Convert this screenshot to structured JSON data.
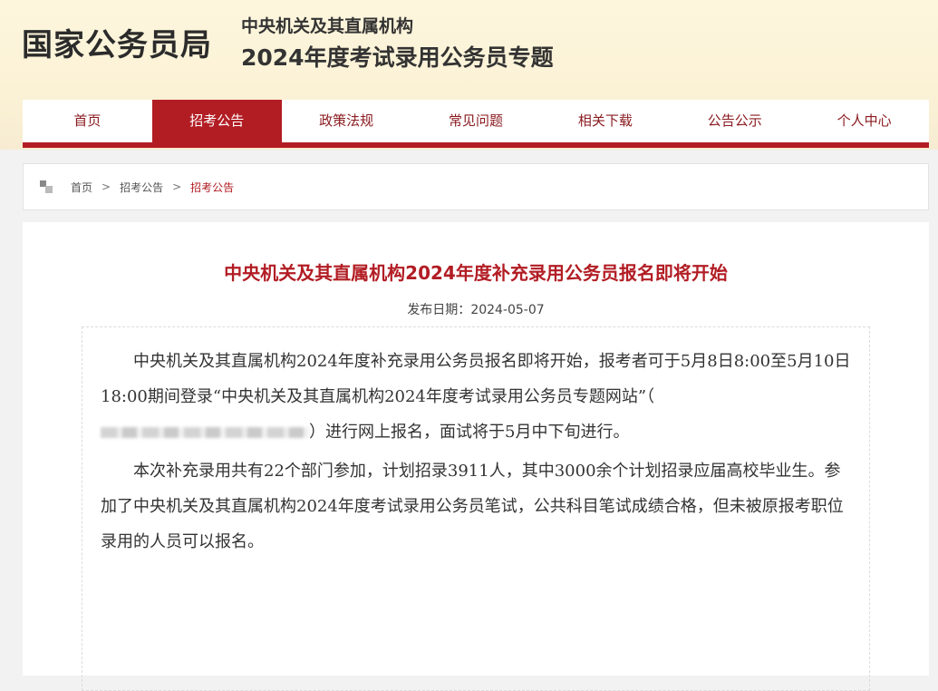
{
  "header": {
    "logo": "国家公务员局",
    "subtitle1": "中央机关及其直属机构",
    "subtitle2": "2024年度考试录用公务员专题"
  },
  "nav": {
    "items": [
      "首页",
      "招考公告",
      "政策法规",
      "常见问题",
      "相关下载",
      "公告公示",
      "个人中心"
    ],
    "active": "招考公告"
  },
  "breadcrumb": {
    "home": "首页",
    "section": "招考公告",
    "current": "招考公告",
    "separator": ">"
  },
  "article": {
    "title": "中央机关及其直属机构2024年度补充录用公务员报名即将开始",
    "date_label": "发布日期：",
    "date": "2024-05-07",
    "p1_before": "中央机关及其直属机构2024年度补充录用公务员报名即将开始，报考者可于5月8日8:00至5月10日18:00期间登录“中央机关及其直属机构2024年度考试录用公务员专题网站”（",
    "p1_after": "）进行网上报名，面试将于5月中下旬进行。",
    "p2": "本次补充录用共有22个部门参加，计划招录3911人，其中3000余个计划招录应届高校毕业生。参加了中央机关及其直属机构2024年度考试录用公务员笔试，公共科目笔试成绩合格，但未被原报考职位录用的人员可以报名。"
  },
  "colors": {
    "accent": "#b21d24",
    "header_bg": "#fdf6dd"
  }
}
